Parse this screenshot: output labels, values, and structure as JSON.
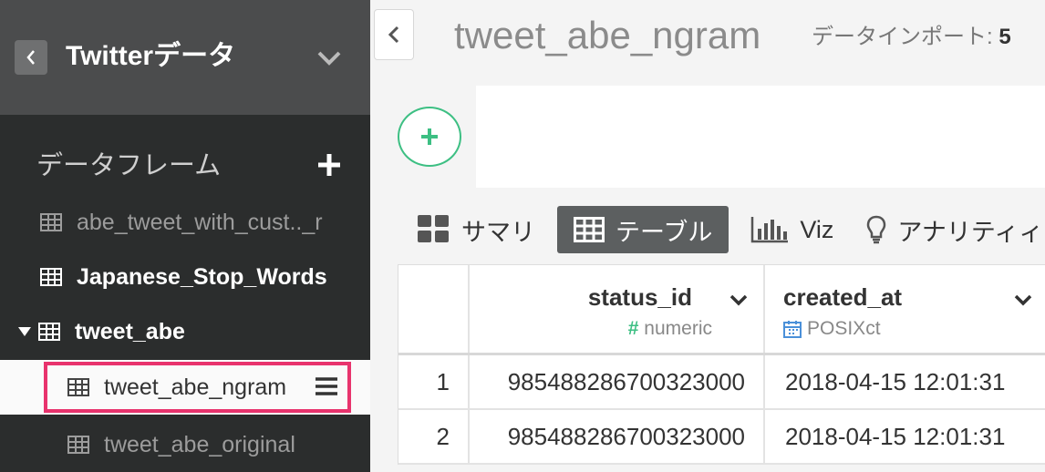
{
  "sidebar": {
    "project_title": "Twitterデータ",
    "section_title": "データフレーム",
    "items": [
      {
        "label": "abe_tweet_with_cust.._r"
      },
      {
        "label": "Japanese_Stop_Words"
      },
      {
        "label": "tweet_abe"
      },
      {
        "label": "tweet_abe_ngram"
      },
      {
        "label": "tweet_abe_original"
      }
    ]
  },
  "main": {
    "title": "tweet_abe_ngram",
    "import_label": "データインポート: ",
    "import_value": "5",
    "tabs": [
      {
        "label": "サマリ"
      },
      {
        "label": "テーブル"
      },
      {
        "label": "Viz"
      },
      {
        "label": "アナリティィ"
      }
    ],
    "table": {
      "columns": [
        {
          "name": "status_id",
          "type_label": "numeric",
          "type_icon": "#"
        },
        {
          "name": "created_at",
          "type_label": "POSIXct",
          "type_icon": "calendar-icon"
        }
      ],
      "rows": [
        {
          "index": "1",
          "status_id": "985488286700323000",
          "created_at": "2018-04-15 12:01:31"
        },
        {
          "index": "2",
          "status_id": "985488286700323000",
          "created_at": "2018-04-15 12:01:31"
        }
      ]
    }
  },
  "colors": {
    "sidebar_bg": "#2b2d2d",
    "header_bg": "#4b4c4d",
    "highlight_border": "#e8336d",
    "accent_green": "#3dbf83"
  }
}
